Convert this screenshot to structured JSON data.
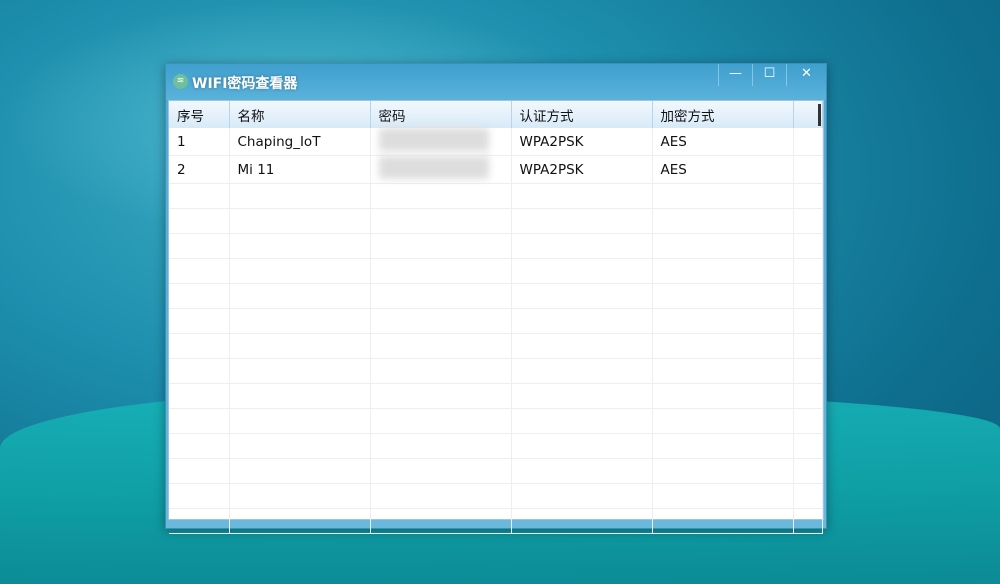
{
  "window": {
    "title": "WIFI密码查看器",
    "icon": "wifi-icon",
    "controls": {
      "minimize": "—",
      "maximize": "☐",
      "close": "✕"
    }
  },
  "table": {
    "columns": [
      "序号",
      "名称",
      "密码",
      "认证方式",
      "加密方式"
    ],
    "rows": [
      {
        "index": "1",
        "name": "Chaping_IoT",
        "auth": "WPA2PSK",
        "cipher": "AES"
      },
      {
        "index": "2",
        "name": "Mi 11",
        "auth": "WPA2PSK",
        "cipher": "AES"
      }
    ]
  }
}
